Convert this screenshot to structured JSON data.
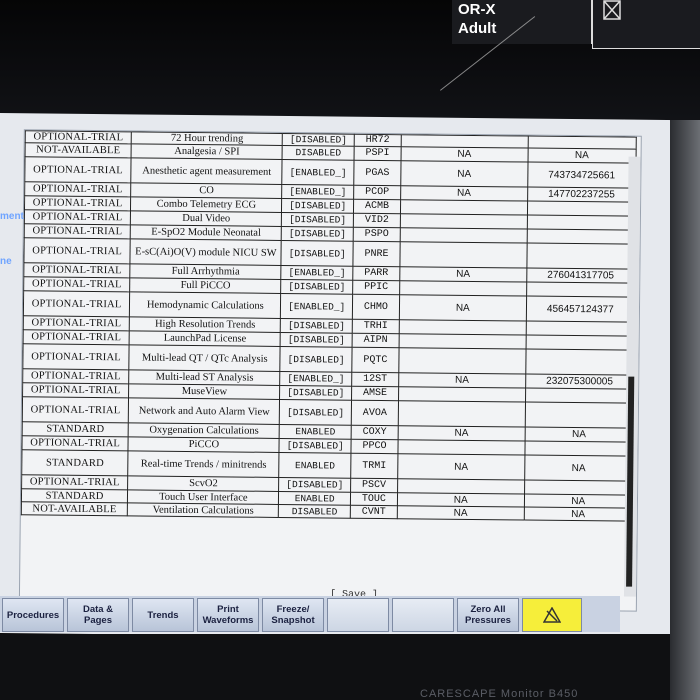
{
  "status_box": {
    "line1": "OR-X",
    "line2": "Adult"
  },
  "side_labels": [
    "ment",
    "ne"
  ],
  "table": {
    "rows": [
      {
        "status": "OPTIONAL-TRIAL",
        "name": "72 Hour trending",
        "state": "[DISABLED]",
        "code": "HR72",
        "val1": "",
        "val2": ""
      },
      {
        "status": "NOT-AVAILABLE",
        "name": "Analgesia / SPI",
        "state": "DISABLED",
        "code": "PSPI",
        "val1": "NA",
        "val2": "NA"
      },
      {
        "status": "OPTIONAL-TRIAL",
        "name": "Anesthetic agent measurement",
        "state": "[ENABLED_]",
        "code": "PGAS",
        "val1": "NA",
        "val2": "743734725661"
      },
      {
        "status": "OPTIONAL-TRIAL",
        "name": "CO",
        "state": "[ENABLED_]",
        "code": "PCOP",
        "val1": "NA",
        "val2": "147702237255"
      },
      {
        "status": "OPTIONAL-TRIAL",
        "name": "Combo Telemetry ECG",
        "state": "[DISABLED]",
        "code": "ACMB",
        "val1": "",
        "val2": ""
      },
      {
        "status": "OPTIONAL-TRIAL",
        "name": "Dual Video",
        "state": "[DISABLED]",
        "code": "VID2",
        "val1": "",
        "val2": ""
      },
      {
        "status": "OPTIONAL-TRIAL",
        "name": "E-SpO2 Module Neonatal",
        "state": "[DISABLED]",
        "code": "PSPO",
        "val1": "",
        "val2": ""
      },
      {
        "status": "OPTIONAL-TRIAL",
        "name": "E-sC(Ai)O(V) module NICU SW",
        "state": "[DISABLED]",
        "code": "PNRE",
        "val1": "",
        "val2": ""
      },
      {
        "status": "OPTIONAL-TRIAL",
        "name": "Full Arrhythmia",
        "state": "[ENABLED_]",
        "code": "PARR",
        "val1": "NA",
        "val2": "276041317705"
      },
      {
        "status": "OPTIONAL-TRIAL",
        "name": "Full PiCCO",
        "state": "[DISABLED]",
        "code": "PPIC",
        "val1": "",
        "val2": ""
      },
      {
        "status": "OPTIONAL-TRIAL",
        "name": "Hemodynamic Calculations",
        "state": "[ENABLED_]",
        "code": "CHMO",
        "val1": "NA",
        "val2": "456457124377"
      },
      {
        "status": "OPTIONAL-TRIAL",
        "name": "High Resolution Trends",
        "state": "[DISABLED]",
        "code": "TRHI",
        "val1": "",
        "val2": ""
      },
      {
        "status": "OPTIONAL-TRIAL",
        "name": "LaunchPad License",
        "state": "[DISABLED]",
        "code": "AIPN",
        "val1": "",
        "val2": ""
      },
      {
        "status": "OPTIONAL-TRIAL",
        "name": "Multi-lead QT / QTc Analysis",
        "state": "[DISABLED]",
        "code": "PQTC",
        "val1": "",
        "val2": ""
      },
      {
        "status": "OPTIONAL-TRIAL",
        "name": "Multi-lead ST Analysis",
        "state": "[ENABLED_]",
        "code": "12ST",
        "val1": "NA",
        "val2": "232075300005"
      },
      {
        "status": "OPTIONAL-TRIAL",
        "name": "MuseView",
        "state": "[DISABLED]",
        "code": "AMSE",
        "val1": "",
        "val2": ""
      },
      {
        "status": "OPTIONAL-TRIAL",
        "name": "Network and Auto Alarm View",
        "state": "[DISABLED]",
        "code": "AVOA",
        "val1": "",
        "val2": ""
      },
      {
        "status": "STANDARD",
        "name": "Oxygenation Calculations",
        "state": "ENABLED",
        "code": "COXY",
        "val1": "NA",
        "val2": "NA"
      },
      {
        "status": "OPTIONAL-TRIAL",
        "name": "PiCCO",
        "state": "[DISABLED]",
        "code": "PPCO",
        "val1": "",
        "val2": ""
      },
      {
        "status": "STANDARD",
        "name": "Real-time Trends / minitrends",
        "state": "ENABLED",
        "code": "TRMI",
        "val1": "NA",
        "val2": "NA"
      },
      {
        "status": "OPTIONAL-TRIAL",
        "name": "ScvO2",
        "state": "[DISABLED]",
        "code": "PSCV",
        "val1": "",
        "val2": ""
      },
      {
        "status": "STANDARD",
        "name": "Touch User Interface",
        "state": "ENABLED",
        "code": "TOUC",
        "val1": "NA",
        "val2": "NA"
      },
      {
        "status": "NOT-AVAILABLE",
        "name": "Ventilation Calculations",
        "state": "DISABLED",
        "code": "CVNT",
        "val1": "NA",
        "val2": "NA"
      }
    ]
  },
  "save_label": "[ Save ]",
  "softkeys": [
    {
      "label": "Procedures",
      "enabled": true
    },
    {
      "label": "Data & Pages",
      "enabled": true
    },
    {
      "label": "Trends",
      "enabled": true
    },
    {
      "label": "Print Waveforms",
      "enabled": true
    },
    {
      "label": "Freeze/ Snapshot",
      "enabled": true
    },
    {
      "label": "",
      "enabled": false
    },
    {
      "label": "",
      "enabled": false
    },
    {
      "label": "Zero All Pressures",
      "enabled": true
    },
    {
      "label": "",
      "enabled": true,
      "icon": "alarm-pause-icon"
    }
  ],
  "brand": "CARESCAPE Monitor B450",
  "colors": {
    "alarm_key": "#f6ee3a",
    "softkey_bar": "#c9d2e2",
    "side_label": "#6fa4ff"
  }
}
